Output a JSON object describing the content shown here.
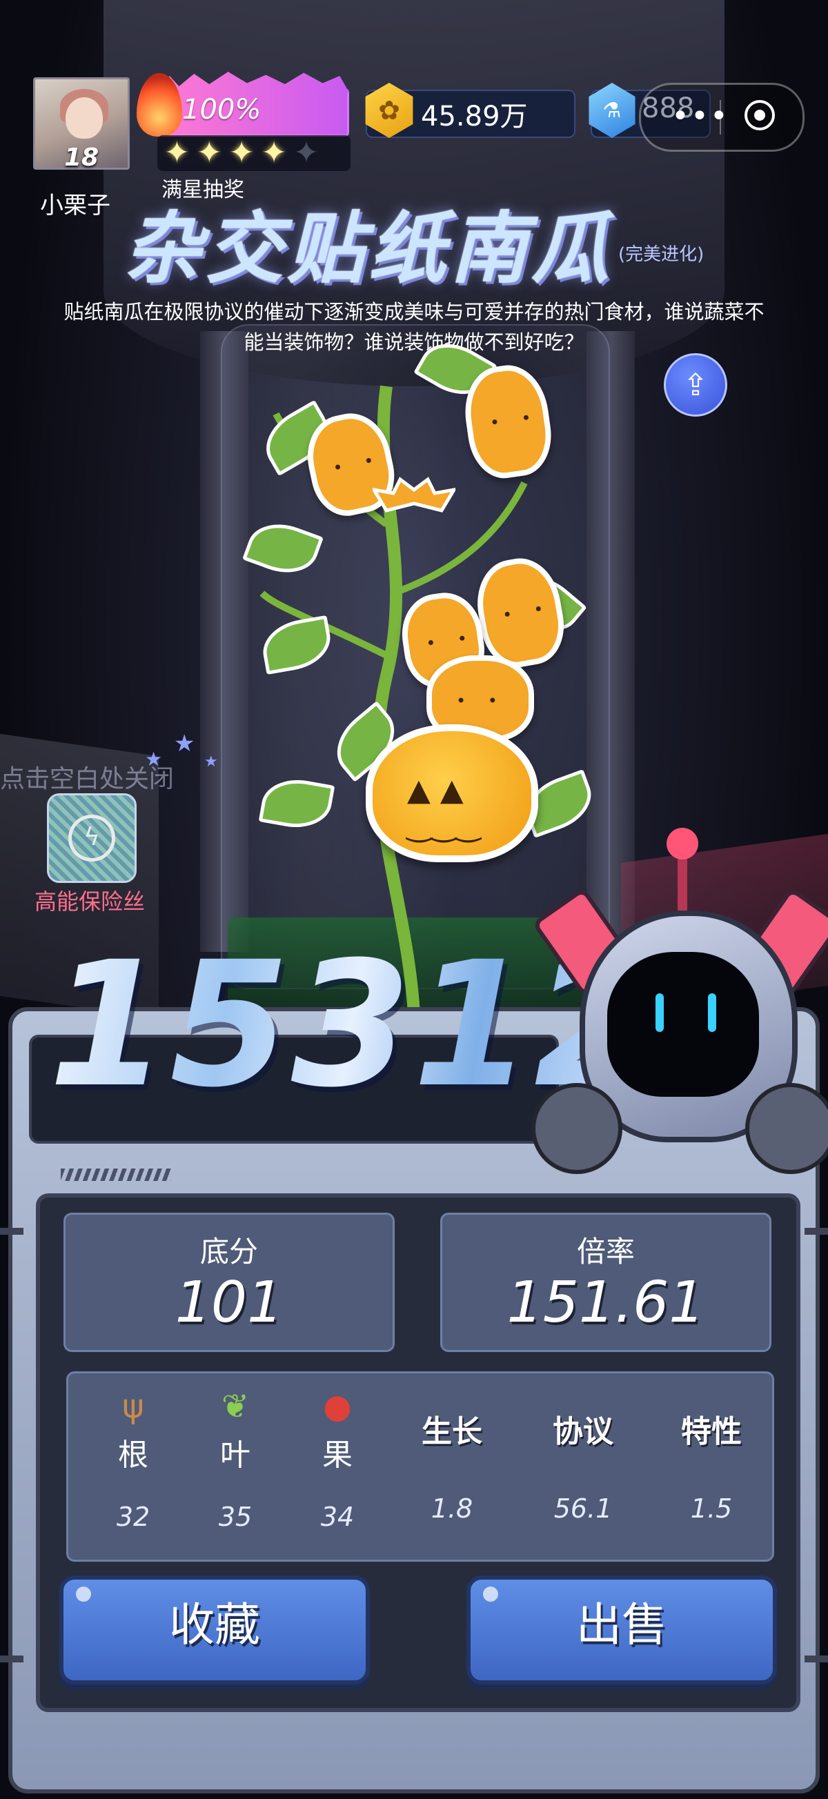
{
  "player": {
    "name": "小栗子",
    "level": "18",
    "energy_percent": "100%",
    "stars_filled": 4,
    "stars_total": 5,
    "star_lottery_label": "满星抽奖"
  },
  "currency": {
    "coins": "45.89万",
    "gems": "888",
    "coin_icon": "coin-icon",
    "gem_icon": "gem-icon"
  },
  "capsule": {
    "more": "•••",
    "record_icon": "record-icon"
  },
  "plant": {
    "name": "杂交贴纸南瓜",
    "evolution_tag": "(完美进化)",
    "description": "贴纸南瓜在极限协议的催动下逐渐变成美味与可爱并存的热门食材，谁说蔬菜不能当装饰物？谁说装饰物做不到好吃？"
  },
  "booster": {
    "close_hint": "点击空白处关闭",
    "label": "高能保险丝"
  },
  "score": {
    "total": "15312",
    "base_label": "底分",
    "base_value": "101",
    "multiplier_label": "倍率",
    "multiplier_value": "151.61"
  },
  "stats": [
    {
      "label": "根",
      "value": "32",
      "icon": "root-icon"
    },
    {
      "label": "叶",
      "value": "35",
      "icon": "leaf-icon"
    },
    {
      "label": "果",
      "value": "34",
      "icon": "fruit-icon"
    },
    {
      "label": "生长",
      "value": "1.8"
    },
    {
      "label": "协议",
      "value": "56.1"
    },
    {
      "label": "特性",
      "value": "1.5"
    }
  ],
  "actions": {
    "collect": "收藏",
    "sell": "出售"
  },
  "colors": {
    "accent_blue": "#3e67c4",
    "energy_pink": "#ff7ad2",
    "booster_pink": "#ff6f8e",
    "panel": "#4f5b78"
  }
}
